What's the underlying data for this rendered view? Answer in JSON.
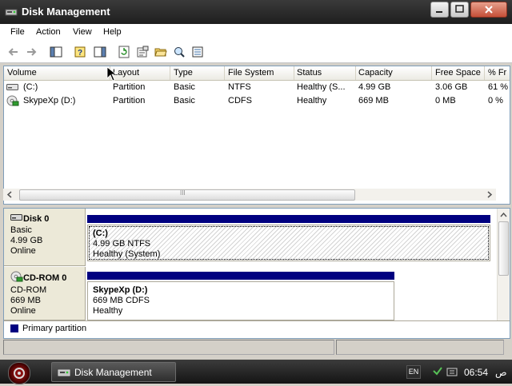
{
  "window": {
    "title": "Disk Management",
    "icon": "disk-management-icon"
  },
  "menu": [
    "File",
    "Action",
    "View",
    "Help"
  ],
  "toolbar": {
    "buttons": [
      "back-icon",
      "forward-icon",
      "show-hide-console-tree-icon",
      "help-icon",
      "show-hide-action-pane-icon",
      "refresh-icon",
      "properties-icon",
      "open-icon",
      "explore-icon",
      "export-list-icon"
    ]
  },
  "volumes": {
    "columns": [
      "Volume",
      "Layout",
      "Type",
      "File System",
      "Status",
      "Capacity",
      "Free Space",
      "% Fr"
    ],
    "rows": [
      {
        "icon": "drive-icon",
        "cells": [
          "(C:)",
          "Partition",
          "Basic",
          "NTFS",
          "Healthy (S...",
          "4.99 GB",
          "3.06 GB",
          "61 %"
        ]
      },
      {
        "icon": "cdrom-icon",
        "cells": [
          "SkypeXp (D:)",
          "Partition",
          "Basic",
          "CDFS",
          "Healthy",
          "669 MB",
          "0 MB",
          "0 %"
        ]
      }
    ],
    "scroll_grip": "III"
  },
  "disks": [
    {
      "name": "Disk 0",
      "icon": "disk-icon",
      "type": "Basic",
      "size": "4.99 GB",
      "state": "Online",
      "partition": {
        "name": "(C:)",
        "detail": "4.99 GB NTFS",
        "status": "Healthy (System)"
      }
    },
    {
      "name": "CD-ROM 0",
      "icon": "cdrom-icon",
      "type": "CD-ROM",
      "size": "669 MB",
      "state": "Online",
      "partition": {
        "name": "SkypeXp  (D:)",
        "detail": "669 MB CDFS",
        "status": "Healthy"
      }
    }
  ],
  "legend": {
    "label": "Primary partition",
    "color": "#000080"
  },
  "taskbar": {
    "task_label": "Disk Management",
    "lang": "EN",
    "time": "06:54",
    "ampm": "ص"
  }
}
